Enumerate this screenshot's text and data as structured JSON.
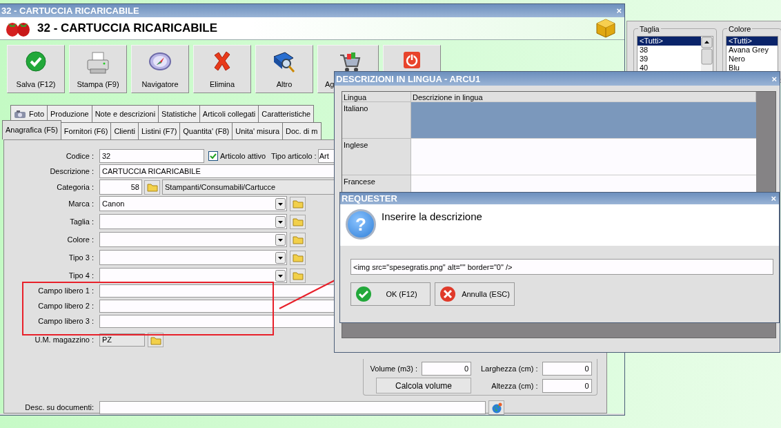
{
  "background_window": {
    "groups": [
      {
        "title": "Taglia",
        "scrollbar": true,
        "items": [
          {
            "label": "<Tutti>",
            "selected": true
          },
          {
            "label": "38",
            "selected": false
          },
          {
            "label": "39",
            "selected": false
          },
          {
            "label": "40",
            "selected": false
          }
        ]
      },
      {
        "title": "Colore",
        "scrollbar": false,
        "items": [
          {
            "label": "<Tutti>",
            "selected": true
          },
          {
            "label": "Avana Grey",
            "selected": false
          },
          {
            "label": "Nero",
            "selected": false
          },
          {
            "label": "Blu",
            "selected": false
          }
        ]
      }
    ]
  },
  "main_window": {
    "title": "32 - CARTUCCIA RICARICABILE",
    "close": "×",
    "header": "32 - CARTUCCIA RICARICABILE",
    "toolbar": [
      {
        "label": "Salva (F12)",
        "kind": "save"
      },
      {
        "label": "Stampa (F9)",
        "kind": "print"
      },
      {
        "label": "Navigatore",
        "kind": "navigate"
      },
      {
        "label": "Elimina",
        "kind": "delete"
      },
      {
        "label": "Altro",
        "kind": "other"
      },
      {
        "label": "Ag",
        "kind": "cart"
      },
      {
        "kind": "exit"
      }
    ],
    "tabs_row_1": [
      {
        "label": "Foto",
        "kind": "camera",
        "selected": false
      },
      {
        "label": "Produzione",
        "selected": false
      },
      {
        "label": "Note e descrizioni",
        "selected": false
      },
      {
        "label": "Statistiche",
        "selected": false
      },
      {
        "label": "Articoli collegati",
        "selected": false
      },
      {
        "label": "Caratteristiche",
        "selected": false
      }
    ],
    "tabs_row_2": [
      {
        "label": "Anagrafica (F5)",
        "selected": true
      },
      {
        "label": "Fornitori (F6)",
        "selected": false
      },
      {
        "label": "Clienti",
        "selected": false
      },
      {
        "label": "Listini (F7)",
        "selected": false
      },
      {
        "label": "Quantita' (F8)",
        "selected": false
      },
      {
        "label": "Unita' misura",
        "selected": false
      },
      {
        "label": "Doc. di m",
        "selected": false
      }
    ],
    "form": {
      "codice": {
        "label": "Codice :",
        "value": "32"
      },
      "active": {
        "label": "Articolo attivo",
        "checked": true
      },
      "tipo_articolo": {
        "label": "Tipo articolo :",
        "value": "Art"
      },
      "descrizione": {
        "label": "Descrizione :",
        "value": "CARTUCCIA RICARICABILE"
      },
      "categoria": {
        "label": "Categoria :",
        "code": "58",
        "path": "Stampanti/Consumabili/Cartucce"
      },
      "combos": [
        {
          "label": "Marca :",
          "value": "Canon"
        },
        {
          "label": "Taglia :"
        },
        {
          "label": "Colore :"
        },
        {
          "label": "Tipo 3 :"
        },
        {
          "label": "Tipo 4 :"
        }
      ],
      "free_fields": [
        {
          "label": "Campo libero 1 :"
        },
        {
          "label": "Campo libero 2 :"
        },
        {
          "label": "Campo libero 3 :"
        }
      ],
      "um": {
        "label": "U.M. magazzino :",
        "value": "PZ"
      },
      "volume": {
        "label": "Volume (m3) :",
        "value": "0"
      },
      "larghezza": {
        "label": "Larghezza (cm) :",
        "value": "0"
      },
      "calc_button": "Calcola volume",
      "altezza": {
        "label": "Altezza (cm) :",
        "value": "0"
      },
      "desc_doc": {
        "label": "Desc. su documenti:"
      }
    }
  },
  "language_dialog": {
    "title": "DESCRIZIONI IN LINGUA - ARCU1",
    "close": "×",
    "columns": [
      "Lingua",
      "Descrizione in lingua"
    ],
    "rows": [
      {
        "language": "Italiano",
        "selected": true
      },
      {
        "language": "Inglese",
        "selected": false
      },
      {
        "language": "Francese",
        "selected": false
      }
    ]
  },
  "requester": {
    "title": "REQUESTER",
    "close": "×",
    "icon": "?",
    "message": "Inserire la descrizione",
    "value": "<img src=\"spesegratis.png\" alt=\"\" border=\"0\" />",
    "buttons": [
      {
        "label": "OK (F12)",
        "kind": "ok"
      },
      {
        "label": "Annulla (ESC)",
        "kind": "cancel"
      }
    ]
  }
}
